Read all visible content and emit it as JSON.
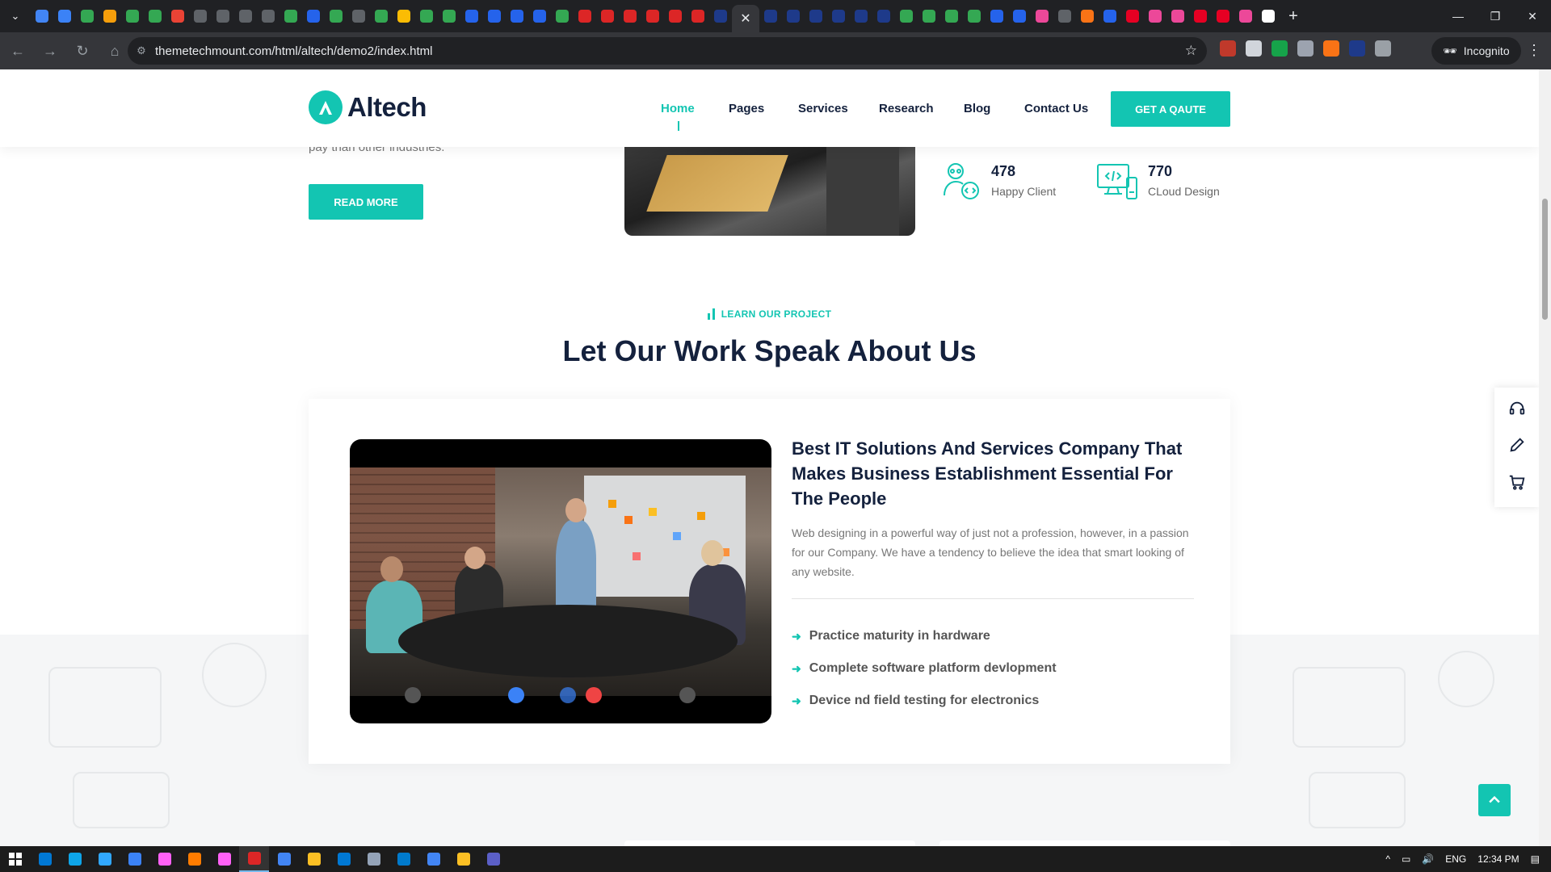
{
  "browser": {
    "url": "themetechmount.com/html/altech/demo2/index.html",
    "incognito_label": "Incognito",
    "tab_colors": [
      "#4285f4",
      "#3b82f6",
      "#34a853",
      "#f59e0b",
      "#34a853",
      "#34a853",
      "#ea4335",
      "#5f6368",
      "#5f6368",
      "#5f6368",
      "#5f6368",
      "#34a853",
      "#2563eb",
      "#34a853",
      "#5f6368",
      "#34a853",
      "#fbbc04",
      "#34a853",
      "#34a853",
      "#2563eb",
      "#2563eb",
      "#2563eb",
      "#2563eb",
      "#34a853",
      "#dc2626",
      "#dc2626",
      "#dc2626",
      "#dc2626",
      "#dc2626",
      "#dc2626",
      "#1e3a8a"
    ],
    "tab_colors_right": [
      "#1e3a8a",
      "#1e3a8a",
      "#1e3a8a",
      "#1e3a8a",
      "#1e3a8a",
      "#1e3a8a",
      "#34a853",
      "#34a853",
      "#34a853",
      "#34a853",
      "#2563eb",
      "#2563eb",
      "#ec4899",
      "#5f6368",
      "#f97316",
      "#2563eb",
      "#e60023",
      "#ec4899",
      "#ec4899",
      "#e60023",
      "#e60023",
      "#ec4899",
      "#ffffff"
    ]
  },
  "header": {
    "logo_text": "Altech",
    "nav": [
      "Home",
      "Pages",
      "Services",
      "Research",
      "Blog",
      "Contact Us"
    ],
    "active_nav": "Home",
    "quote_button": "GET A QAUTE"
  },
  "intro": {
    "partial_text": "pay than other industries.",
    "read_more": "READ MORE"
  },
  "stats": [
    {
      "number": "478",
      "label": "Happy Client",
      "icon": "happy-client-icon"
    },
    {
      "number": "770",
      "label": "CLoud Design",
      "icon": "cloud-design-icon"
    }
  ],
  "projects": {
    "tag": "LEARN OUR PROJECT",
    "title": "Let Our Work Speak About Us",
    "card_heading": "Best IT Solutions And Services Company That Makes Business Establishment Essential For The People",
    "card_desc": "Web designing in a powerful way of just not a profession, however, in a passion for our Company. We have a tendency to believe the idea that smart looking of any website.",
    "features": [
      "Practice maturity in hardware",
      "Complete software platform devlopment",
      "Device nd field testing for electronics"
    ]
  },
  "dock": [
    "headset-icon",
    "pencil-icon",
    "cart-icon"
  ],
  "taskbar": {
    "apps": [
      "#0078d4",
      "#0ea5e9",
      "#31a8ff",
      "#3b82f6",
      "#ff61f6",
      "#ff7c00",
      "#ff61f6",
      "#dc2626",
      "#4285f4",
      "#fbbf24",
      "#0078d4",
      "#94a3b8",
      "#007acc",
      "#4285f4",
      "#fbbf24",
      "#5b5fc7"
    ],
    "lang": "ENG",
    "time": "12:34 PM"
  },
  "colors": {
    "accent": "#13c5b2",
    "heading": "#14213d"
  }
}
